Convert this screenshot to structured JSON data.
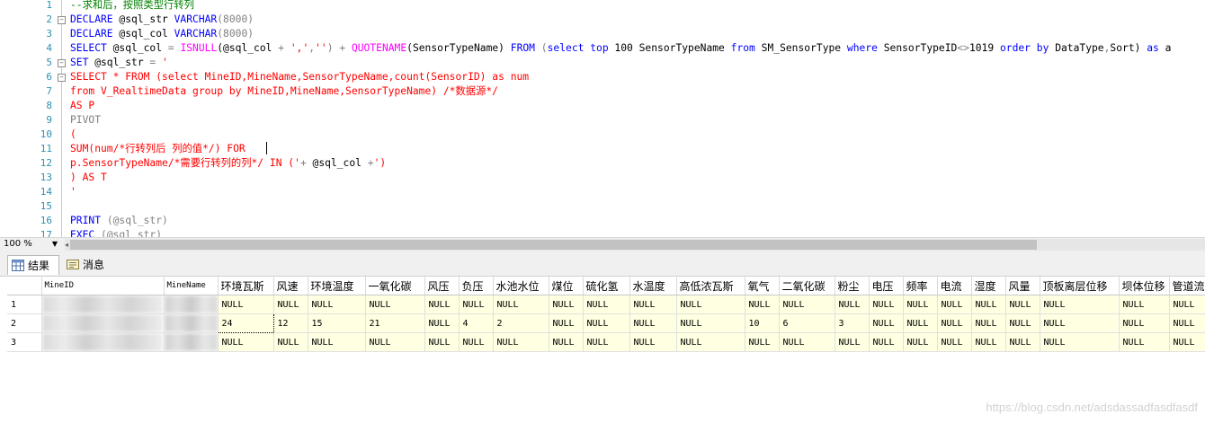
{
  "editor": {
    "line_numbers": [
      "1",
      "2",
      "3",
      "4",
      "5",
      "6",
      "7",
      "8",
      "9",
      "10",
      "11",
      "12",
      "13",
      "14",
      "15",
      "16",
      "17"
    ],
    "lines": [
      [
        {
          "t": "--求和后，按照类型行转列",
          "c": "cm"
        }
      ],
      [
        {
          "t": "DECLARE",
          "c": "kw"
        },
        {
          "t": " @sql_str ",
          "c": "pl"
        },
        {
          "t": "VARCHAR",
          "c": "kw"
        },
        {
          "t": "(8000)",
          "c": "gr"
        }
      ],
      [
        {
          "t": "DECLARE",
          "c": "kw"
        },
        {
          "t": " @sql_col ",
          "c": "pl"
        },
        {
          "t": "VARCHAR",
          "c": "kw"
        },
        {
          "t": "(8000)",
          "c": "gr"
        }
      ],
      [
        {
          "t": "SELECT",
          "c": "kw"
        },
        {
          "t": " @sql_col ",
          "c": "pl"
        },
        {
          "t": "=",
          "c": "gr"
        },
        {
          "t": " ISNULL",
          "c": "fn"
        },
        {
          "t": "(@sql_col ",
          "c": "pl"
        },
        {
          "t": "+",
          "c": "gr"
        },
        {
          "t": " ','",
          "c": "str"
        },
        {
          "t": ",",
          "c": "gr"
        },
        {
          "t": "''",
          "c": "str"
        },
        {
          "t": ") ",
          "c": "gr"
        },
        {
          "t": "+",
          "c": "gr"
        },
        {
          "t": " QUOTENAME",
          "c": "fn"
        },
        {
          "t": "(SensorTypeName) ",
          "c": "pl"
        },
        {
          "t": "FROM",
          "c": "kw"
        },
        {
          "t": " (",
          "c": "gr"
        },
        {
          "t": "select top",
          "c": "kw"
        },
        {
          "t": " 100 SensorTypeName ",
          "c": "pl"
        },
        {
          "t": "from",
          "c": "kw"
        },
        {
          "t": " SM_SensorType ",
          "c": "pl"
        },
        {
          "t": "where",
          "c": "kw"
        },
        {
          "t": " SensorTypeID",
          "c": "pl"
        },
        {
          "t": "<>",
          "c": "gr"
        },
        {
          "t": "1019 ",
          "c": "pl"
        },
        {
          "t": "order by",
          "c": "kw"
        },
        {
          "t": " DataType",
          "c": "pl"
        },
        {
          "t": ",",
          "c": "gr"
        },
        {
          "t": "Sort) ",
          "c": "pl"
        },
        {
          "t": "as",
          "c": "kw"
        },
        {
          "t": " a",
          "c": "pl"
        }
      ],
      [
        {
          "t": "SET",
          "c": "kw"
        },
        {
          "t": " @sql_str ",
          "c": "pl"
        },
        {
          "t": "=",
          "c": "gr"
        },
        {
          "t": " '",
          "c": "str"
        }
      ],
      [
        {
          "t": "SELECT * FROM (select MineID,MineName,SensorTypeName,count(SensorID) as num",
          "c": "str"
        }
      ],
      [
        {
          "t": "from V_RealtimeData group by MineID,MineName,SensorTypeName) /*数据源*/",
          "c": "str"
        }
      ],
      [
        {
          "t": "AS P",
          "c": "str"
        }
      ],
      [
        {
          "t": "PIVOT",
          "c": "gr"
        }
      ],
      [
        {
          "t": "(",
          "c": "str"
        }
      ],
      [
        {
          "t": "SUM(num/*行转列后 列的值*/) FOR",
          "c": "str"
        }
      ],
      [
        {
          "t": "p.SensorTypeName/*需要行转列的列*/ IN (",
          "c": "str"
        },
        {
          "t": "'",
          "c": "str"
        },
        {
          "t": "+",
          "c": "gr"
        },
        {
          "t": " @sql_col ",
          "c": "pl"
        },
        {
          "t": "+",
          "c": "gr"
        },
        {
          "t": "'",
          "c": "str"
        },
        {
          "t": ")",
          "c": "str"
        }
      ],
      [
        {
          "t": ") AS T",
          "c": "str"
        }
      ],
      [
        {
          "t": "'",
          "c": "str"
        }
      ],
      [
        {
          "t": "",
          "c": "pl"
        }
      ],
      [
        {
          "t": "PRINT",
          "c": "kw"
        },
        {
          "t": " (@sql_str)",
          "c": "gr"
        }
      ],
      [
        {
          "t": "EXEC",
          "c": "kw"
        },
        {
          "t": " (@sql_str)",
          "c": "gr"
        }
      ]
    ]
  },
  "zoom": {
    "value": "100 %"
  },
  "tabs": {
    "results": "结果",
    "messages": "消息"
  },
  "grid": {
    "headers": [
      "MineID",
      "MineName",
      "环境瓦斯",
      "风速",
      "环境温度",
      "一氧化碳",
      "风压",
      "负压",
      "水池水位",
      "煤位",
      "硫化氢",
      "水温度",
      "高低浓瓦斯",
      "氧气",
      "二氧化碳",
      "粉尘",
      "电压",
      "频率",
      "电流",
      "湿度",
      "风量",
      "顶板离层位移",
      "坝体位移",
      "管道流"
    ],
    "rows": [
      {
        "num": "1",
        "cells": [
          "NULL",
          "NULL",
          "NULL",
          "NULL",
          "NULL",
          "NULL",
          "NULL",
          "NULL",
          "NULL",
          "NULL",
          "NULL",
          "NULL",
          "NULL",
          "NULL",
          "NULL",
          "NULL",
          "NULL",
          "NULL",
          "NULL",
          "NULL",
          "NULL",
          "NULL"
        ]
      },
      {
        "num": "2",
        "cells": [
          "24",
          "12",
          "15",
          "21",
          "NULL",
          "4",
          "2",
          "NULL",
          "NULL",
          "NULL",
          "NULL",
          "10",
          "6",
          "3",
          "NULL",
          "NULL",
          "NULL",
          "NULL",
          "NULL",
          "NULL",
          "NULL",
          "NULL"
        ]
      },
      {
        "num": "3",
        "cells": [
          "NULL",
          "NULL",
          "NULL",
          "NULL",
          "NULL",
          "NULL",
          "NULL",
          "NULL",
          "NULL",
          "NULL",
          "NULL",
          "NULL",
          "NULL",
          "NULL",
          "NULL",
          "NULL",
          "NULL",
          "NULL",
          "NULL",
          "NULL",
          "NULL",
          "NULL"
        ]
      }
    ]
  },
  "watermark": "https://blog.csdn.net/adsdassadfasdfasdf"
}
